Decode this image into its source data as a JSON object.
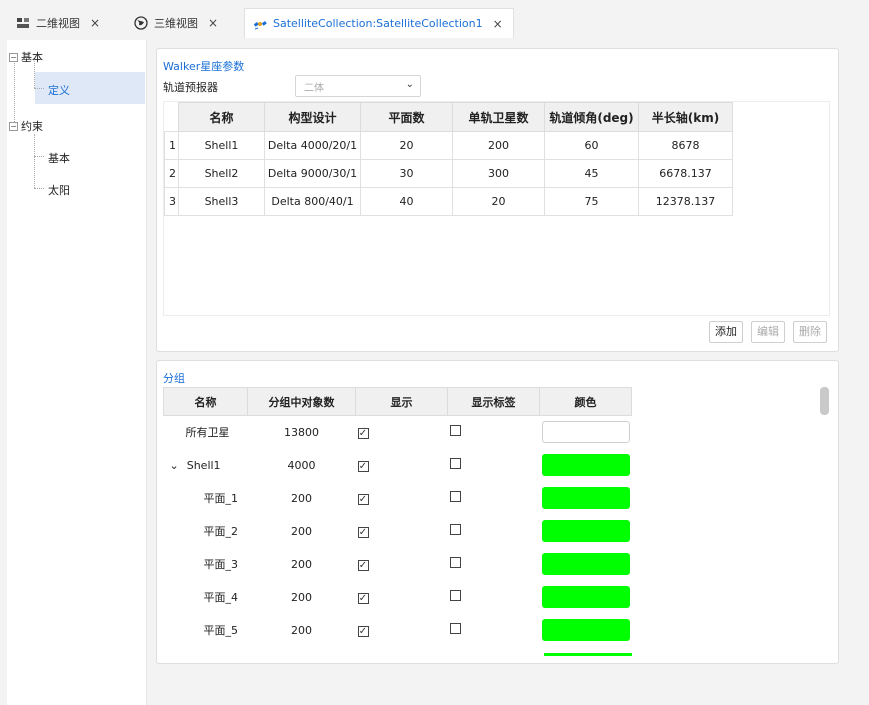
{
  "tabs": [
    {
      "label": "二维视图",
      "icon": "map-2d-icon",
      "close": "×"
    },
    {
      "label": "三维视图",
      "icon": "globe-icon",
      "close": "×"
    },
    {
      "label": "SatelliteCollection:SatelliteCollection1",
      "icon": "satellite-icon",
      "close": "×"
    }
  ],
  "tree": {
    "group1": {
      "toggle": "−",
      "label": "基本"
    },
    "group1_child": "定义",
    "group2": {
      "toggle": "−",
      "label": "约束"
    },
    "group2_children": [
      "基本",
      "太阳"
    ]
  },
  "walker": {
    "title": "Walker星座参数",
    "propagator_label": "轨道预报器",
    "propagator_value": "二体",
    "columns": [
      "名称",
      "构型设计",
      "平面数",
      "单轨卫星数",
      "轨道倾角(deg)",
      "半长轴(km)"
    ],
    "rows": [
      {
        "num": "1",
        "cells": [
          "Shell1",
          "Delta 4000/20/1",
          "20",
          "200",
          "60",
          "8678"
        ]
      },
      {
        "num": "2",
        "cells": [
          "Shell2",
          "Delta 9000/30/1",
          "30",
          "300",
          "45",
          "6678.137"
        ]
      },
      {
        "num": "3",
        "cells": [
          "Shell3",
          "Delta 800/40/1",
          "40",
          "20",
          "75",
          "12378.137"
        ]
      }
    ],
    "buttons": {
      "add": "添加",
      "edit": "编辑",
      "delete": "删除"
    }
  },
  "groups": {
    "title": "分组",
    "columns": [
      "名称",
      "分组中对象数",
      "显示",
      "显示标签",
      "颜色"
    ],
    "rows": [
      {
        "name": "所有卫星",
        "count": "13800",
        "show": true,
        "show_label": false,
        "color": "#ffffff",
        "indent": 0,
        "expander": ""
      },
      {
        "name": "Shell1",
        "count": "4000",
        "show": true,
        "show_label": false,
        "color": "#00ff00",
        "indent": 0,
        "expander": "⌄"
      },
      {
        "name": "平面_1",
        "count": "200",
        "show": true,
        "show_label": false,
        "color": "#00ff00",
        "indent": 1,
        "expander": ""
      },
      {
        "name": "平面_2",
        "count": "200",
        "show": true,
        "show_label": false,
        "color": "#00ff00",
        "indent": 1,
        "expander": ""
      },
      {
        "name": "平面_3",
        "count": "200",
        "show": true,
        "show_label": false,
        "color": "#00ff00",
        "indent": 1,
        "expander": ""
      },
      {
        "name": "平面_4",
        "count": "200",
        "show": true,
        "show_label": false,
        "color": "#00ff00",
        "indent": 1,
        "expander": ""
      },
      {
        "name": "平面_5",
        "count": "200",
        "show": true,
        "show_label": false,
        "color": "#00ff00",
        "indent": 1,
        "expander": ""
      }
    ]
  },
  "colors": {
    "accent": "#1a6fd6",
    "selection": "#dfe8f6",
    "green": "#00ff00"
  }
}
